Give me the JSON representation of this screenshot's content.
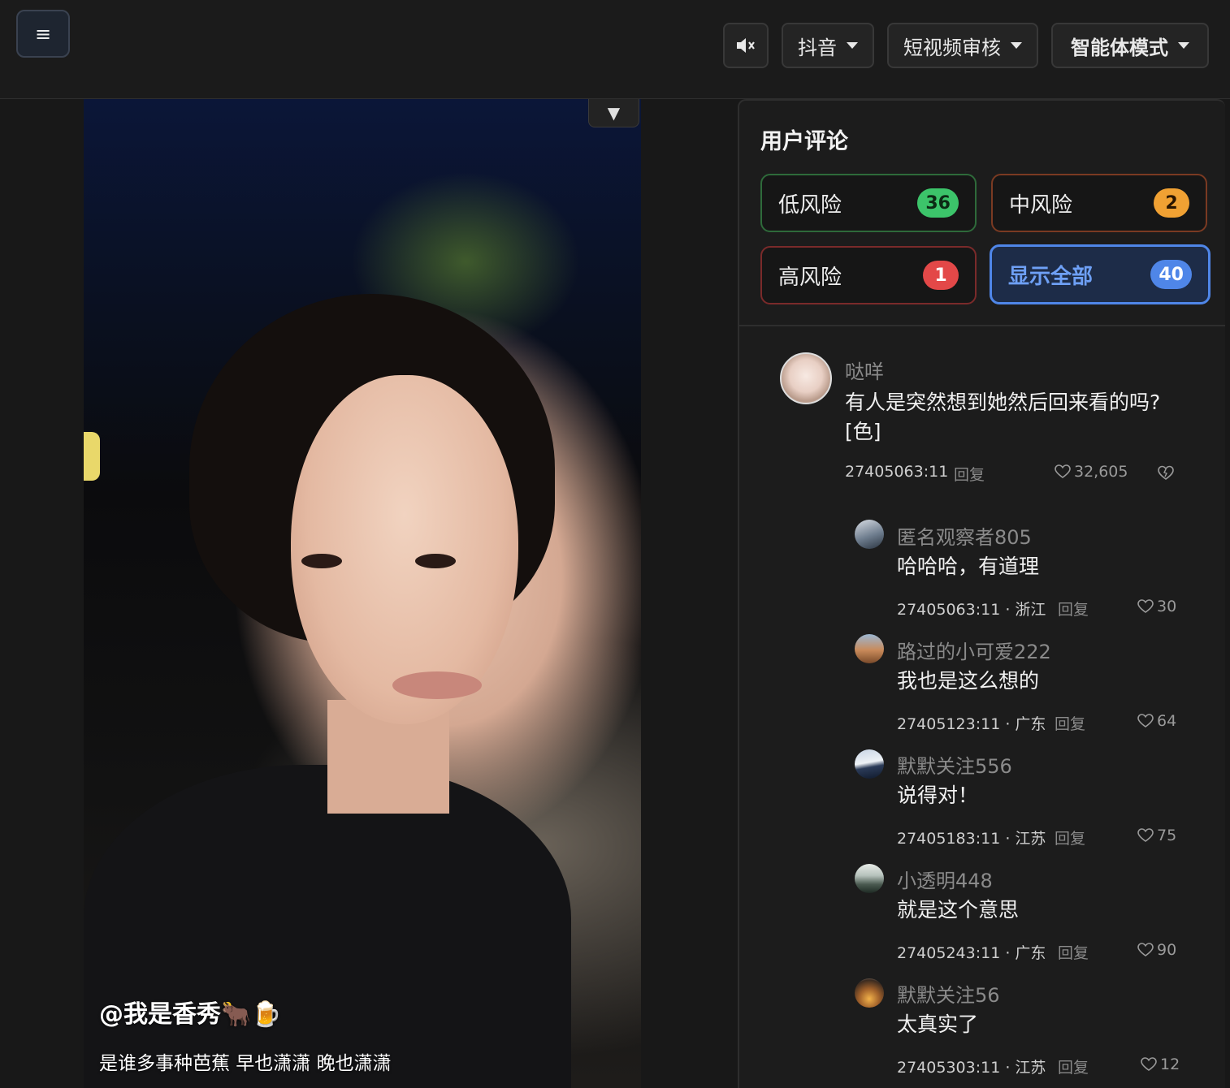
{
  "topbar": {
    "menu_icon": "≡",
    "platform_label": "抖音",
    "review_label": "短视频审核",
    "agent_label": "智能体模式"
  },
  "video": {
    "collapse_icon": "▼",
    "author": "@我是香秀🐂🍺",
    "description": "是谁多事种芭蕉 早也潇潇 晚也潇潇"
  },
  "panel": {
    "title": "用户评论",
    "filters": {
      "low": {
        "label": "低风险",
        "count": "36"
      },
      "mid": {
        "label": "中风险",
        "count": "2"
      },
      "high": {
        "label": "高风险",
        "count": "1"
      },
      "all": {
        "label": "显示全部",
        "count": "40"
      }
    },
    "main_comment": {
      "name": "哒咩",
      "text_line1": "有人是突然想到她然后回来看的吗?",
      "text_line2": "[色]",
      "meta": "27405063:11",
      "reply": "回复",
      "likes": "32,605"
    },
    "replies": [
      {
        "name": "匿名观察者805",
        "text": "哈哈哈，有道理",
        "meta": "27405063:11 · 浙江",
        "reply": "回复",
        "likes": "30"
      },
      {
        "name": "路过的小可爱222",
        "text": "我也是这么想的",
        "meta": "27405123:11 · 广东",
        "reply": "回复",
        "likes": "64"
      },
      {
        "name": "默默关注556",
        "text": "说得对！",
        "meta": "27405183:11 · 江苏",
        "reply": "回复",
        "likes": "75"
      },
      {
        "name": "小透明448",
        "text": "就是这个意思",
        "meta": "27405243:11 · 广东",
        "reply": "回复",
        "likes": "90"
      },
      {
        "name": "默默关注56",
        "text": "太真实了",
        "meta": "27405303:11 · 江苏",
        "reply": "回复",
        "likes": "12"
      }
    ]
  },
  "colors": {
    "accent_blue": "#4f86e8",
    "low_green": "#3cc46a",
    "mid_orange": "#f0a133",
    "high_red": "#e34848"
  }
}
